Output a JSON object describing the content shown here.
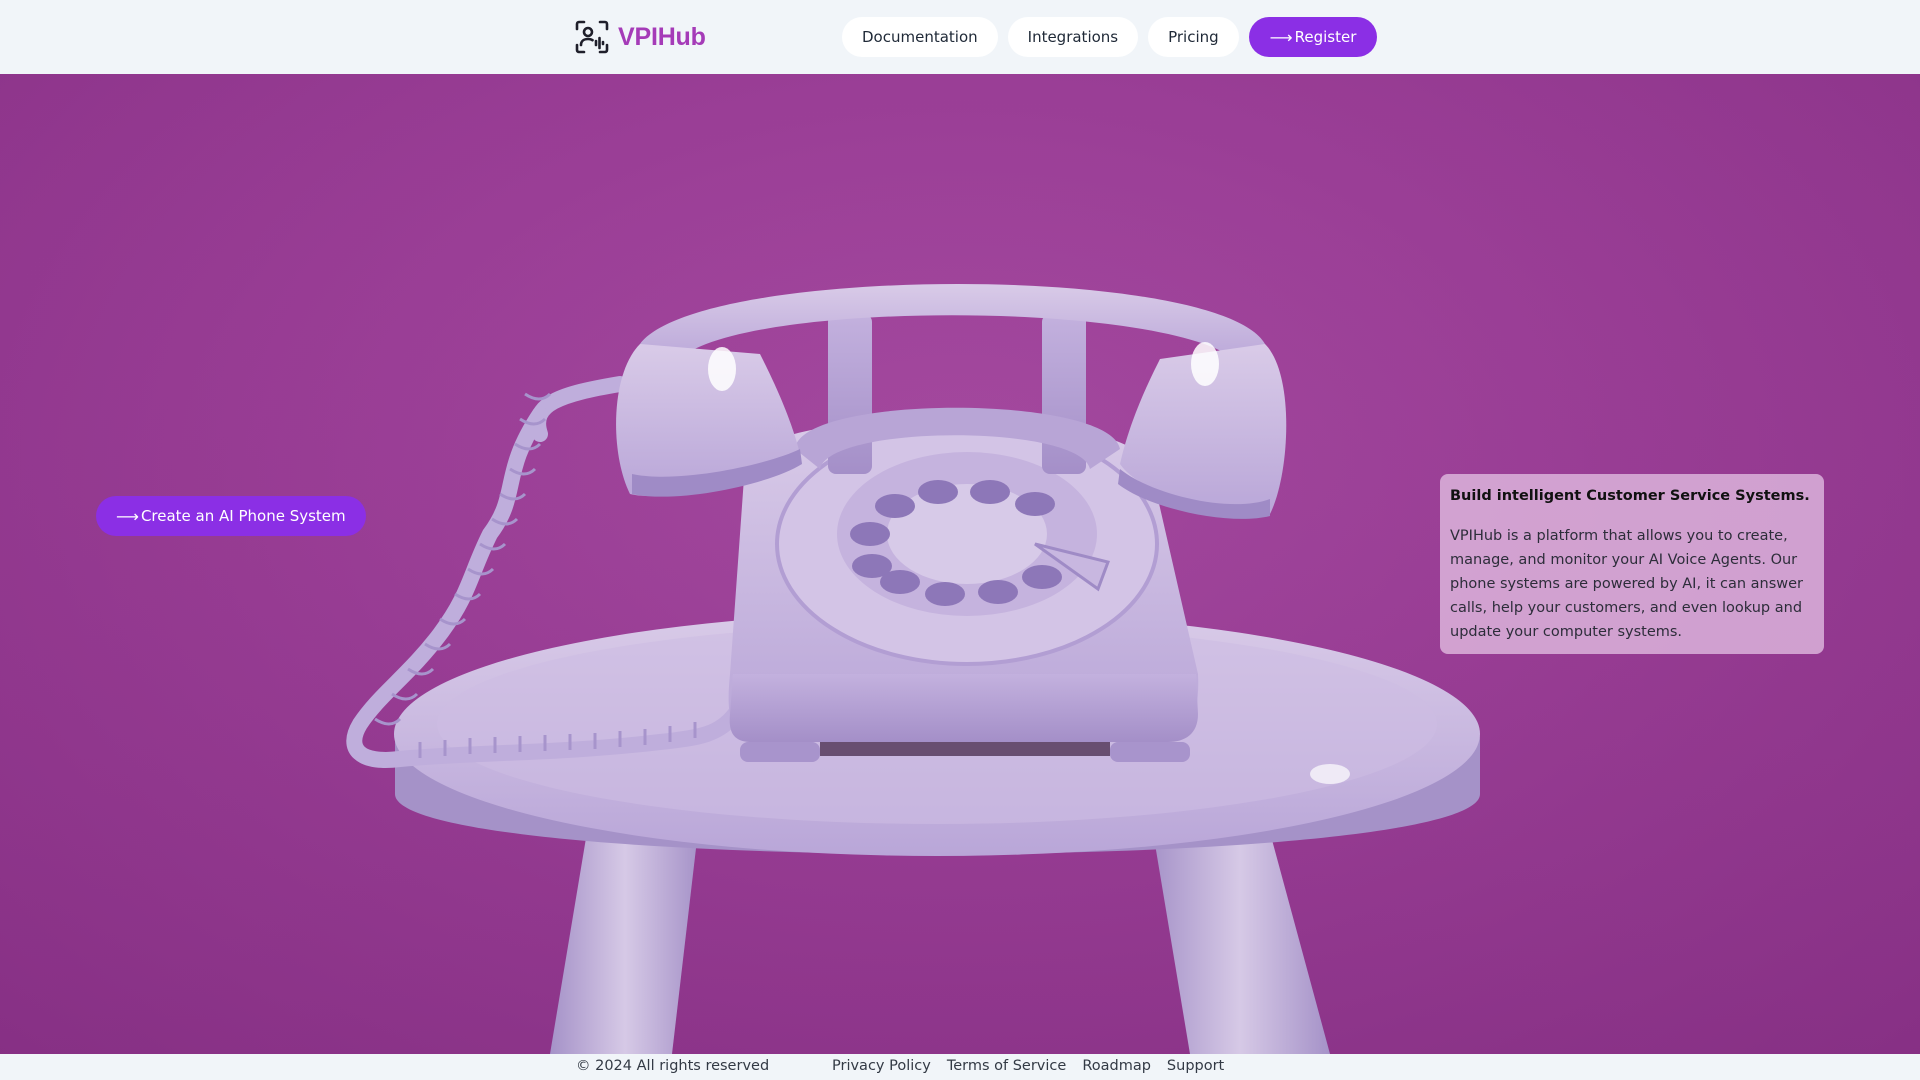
{
  "header": {
    "logo_icon": "face-scan-microphone-icon",
    "brand": "VPIHub",
    "nav": [
      {
        "label": "Documentation"
      },
      {
        "label": "Integrations"
      },
      {
        "label": "Pricing"
      }
    ],
    "register": {
      "arrow": "⟶",
      "label": "Register"
    }
  },
  "hero": {
    "image": "purple-rotary-telephone-on-stool",
    "cta": {
      "arrow": "⟶",
      "label": "Create an AI Phone System"
    },
    "card": {
      "title": "Build intelligent Customer Service Systems.",
      "body": "VPIHub is a platform that allows you to create, manage, and monitor your AI Voice Agents. Our phone systems are powered by AI, it can answer calls, help your customers, and even lookup and update your computer systems."
    }
  },
  "footer": {
    "copyright": "© 2024 All rights reserved",
    "links": [
      {
        "label": "Privacy Policy"
      },
      {
        "label": "Terms of Service"
      },
      {
        "label": "Roadmap"
      },
      {
        "label": "Support"
      }
    ]
  },
  "colors": {
    "brand": "#a53bb8",
    "accent": "#8b2fe5",
    "hero_background": "#9a3e96",
    "page_background": "#f1f5f9"
  }
}
